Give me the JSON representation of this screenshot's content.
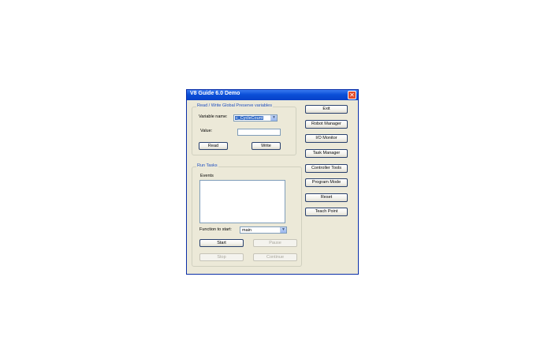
{
  "window": {
    "title": "V8 Guide 6.0 Demo",
    "close_glyph": "✕"
  },
  "read_write_group": {
    "label": "Read / Write Global Preserve variables",
    "variable_name_label": "Variable name:",
    "variable_name_value": "c_CycleCount",
    "value_label": "Value:",
    "value_text": "",
    "read_button": "Read",
    "write_button": "Write"
  },
  "run_tasks_group": {
    "label": "Run Tasks",
    "events_label": "Events",
    "function_label": "Function to start:",
    "function_value": "main",
    "start_button": "Start",
    "pause_button": "Pause",
    "stop_button": "Stop",
    "continue_button": "Continue"
  },
  "side_buttons": {
    "exit": "Exit",
    "robot_manager": "Robot Manager",
    "io_monitor": "I/O Monitor",
    "task_manager": "Task Manager",
    "controller_tools": "Controller Tools",
    "program_mode": "Program Mode",
    "reset": "Reset",
    "teach_point": "Teach Point"
  },
  "icons": {
    "dropdown_arrow": "▼"
  },
  "colors": {
    "titlebar": "#0b4fd8",
    "window_bg": "#ece9d8",
    "group_label": "#1f4fc1",
    "selection": "#316ac5"
  }
}
